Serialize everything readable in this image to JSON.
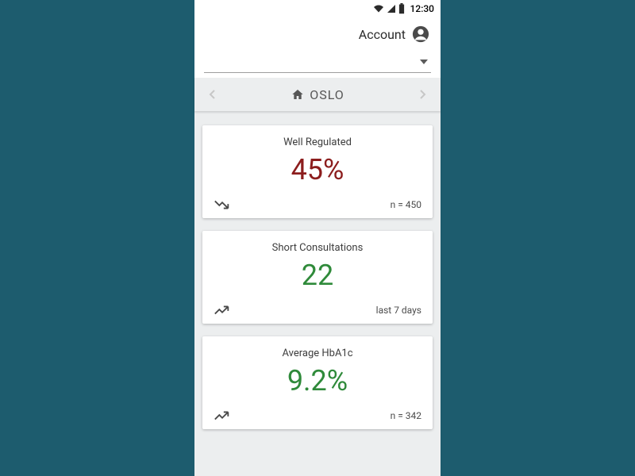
{
  "statusbar": {
    "time": "12:30"
  },
  "header": {
    "account_label": "Account",
    "location": "OSLO"
  },
  "cards": [
    {
      "title": "Well Regulated",
      "value": "45%",
      "value_color": "red",
      "trend": "down",
      "footer": "n = 450"
    },
    {
      "title": "Short Consultations",
      "value": "22",
      "value_color": "green",
      "trend": "up",
      "footer": "last 7 days"
    },
    {
      "title": "Average HbA1c",
      "value": "9.2%",
      "value_color": "green",
      "trend": "up",
      "footer": "n = 342"
    }
  ]
}
